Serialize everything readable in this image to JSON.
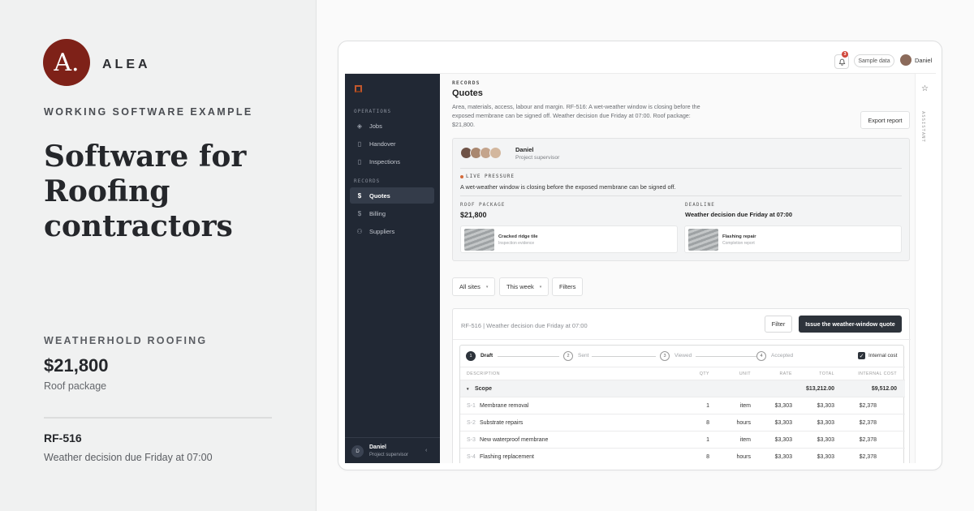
{
  "brand": {
    "logo_letter": "A.",
    "name": "ALEA",
    "color": "#7e2118"
  },
  "hero": {
    "kicker": "WORKING SOFTWARE EXAMPLE",
    "headline": "Software for Roofing contractors",
    "client": "WEATHERHOLD ROOFING",
    "amount": "$21,800",
    "amount_caption": "Roof package",
    "ref_id": "RF-516",
    "ref_desc": "Weather decision due Friday at 07:00"
  },
  "topbar": {
    "notification_count": "3",
    "sample_data": "Sample data",
    "user": "Daniel"
  },
  "sidebar": {
    "sections": {
      "operations": "OPERATIONS",
      "records": "RECORDS"
    },
    "items": [
      {
        "label": "Jobs",
        "icon": "layers-icon"
      },
      {
        "label": "Handover",
        "icon": "clipboard-icon"
      },
      {
        "label": "Inspections",
        "icon": "clipboard-check-icon"
      },
      {
        "label": "Quotes",
        "icon": "dollar-icon",
        "active": true
      },
      {
        "label": "Billing",
        "icon": "dollar-icon"
      },
      {
        "label": "Suppliers",
        "icon": "users-icon"
      }
    ],
    "footer": {
      "initial": "D",
      "name": "Daniel",
      "role": "Project supervisor"
    }
  },
  "page": {
    "breadcrumb": "RECORDS",
    "title": "Quotes",
    "description": "Area, materials, access, labour and margin. RF-516: A wet-weather window is closing before the exposed membrane can be signed off. Weather decision due Friday at 07:00. Roof package: $21,800.",
    "export_label": "Export report"
  },
  "card": {
    "name": "Daniel",
    "role": "Project supervisor",
    "live_label": "LIVE PRESSURE",
    "live_text": "A wet-weather window is closing before the exposed membrane can be signed off.",
    "package_label": "ROOF PACKAGE",
    "package_value": "$21,800",
    "deadline_label": "DEADLINE",
    "deadline_value": "Weather decision due Friday at 07:00",
    "attachments": [
      {
        "title": "Cracked ridge tile",
        "subtitle": "Inspection evidence"
      },
      {
        "title": "Flashing repair",
        "subtitle": "Completion report"
      }
    ]
  },
  "filters": {
    "site": "All sites",
    "period": "This week",
    "more": "Filters"
  },
  "quote": {
    "header": "RF-516 | Weather decision due Friday at 07:00",
    "filter_label": "Filter",
    "issue_label": "Issue the weather-window quote",
    "steps": [
      {
        "num": "1",
        "label": "Draft"
      },
      {
        "num": "2",
        "label": "Sent"
      },
      {
        "num": "3",
        "label": "Viewed"
      },
      {
        "num": "4",
        "label": "Accepted"
      }
    ],
    "internal_cost_label": "Internal cost",
    "columns": {
      "description": "DESCRIPTION",
      "qty": "QTY",
      "unit": "UNIT",
      "rate": "RATE",
      "total": "TOTAL",
      "internal": "INTERNAL COST"
    },
    "group": {
      "label": "Scope",
      "total": "$13,212.00",
      "internal": "$9,512.00"
    },
    "rows": [
      {
        "code": "S-1",
        "desc": "Membrane removal",
        "qty": "1",
        "unit": "item",
        "rate": "$3,303",
        "total": "$3,303",
        "internal": "$2,378"
      },
      {
        "code": "S-2",
        "desc": "Substrate repairs",
        "qty": "8",
        "unit": "hours",
        "rate": "$3,303",
        "total": "$3,303",
        "internal": "$2,378"
      },
      {
        "code": "S-3",
        "desc": "New waterproof membrane",
        "qty": "1",
        "unit": "item",
        "rate": "$3,303",
        "total": "$3,303",
        "internal": "$2,378"
      },
      {
        "code": "S-4",
        "desc": "Flashing replacement",
        "qty": "8",
        "unit": "hours",
        "rate": "$3,303",
        "total": "$3,303",
        "internal": "$2,378"
      }
    ]
  },
  "assistant": {
    "label": "ASSISTANT"
  }
}
